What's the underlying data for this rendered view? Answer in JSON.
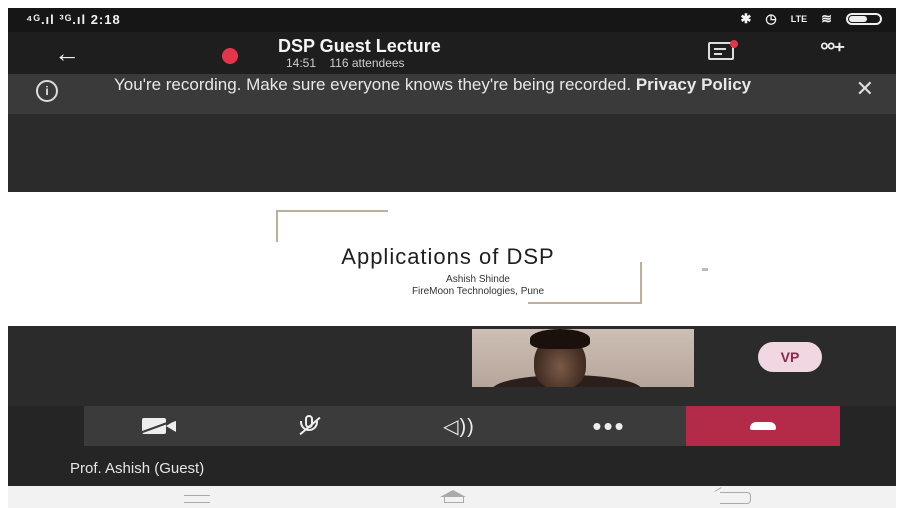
{
  "status_bar": {
    "left": "⁴ᴳ.ıl ³ᴳ.ıl 2:18",
    "right_icons": [
      "bluetooth-icon",
      "alarm-icon",
      "volte-icon",
      "wifi-icon",
      "battery-icon"
    ]
  },
  "header": {
    "title": "DSP Guest Lecture",
    "duration": "14:51",
    "attendees": "116 attendees"
  },
  "banner": {
    "message": "You're recording. Make sure everyone knows they're being recorded.",
    "link": "Privacy Policy"
  },
  "slide": {
    "title": "Applications of DSP",
    "author": "Ashish Shinde",
    "company": "FireMoon Technologies, Pune"
  },
  "participant": {
    "avatar_initials": "VP",
    "name_label": "Prof. Ashish (Guest)"
  },
  "controls": {
    "items": [
      "video-off",
      "mic-off",
      "speaker",
      "more-options",
      "hang-up"
    ],
    "hangup_color": "#b32b49"
  },
  "colors": {
    "recording_dot": "#e3364b",
    "avatar_bg": "#f0d7e2",
    "background": "#252525"
  }
}
